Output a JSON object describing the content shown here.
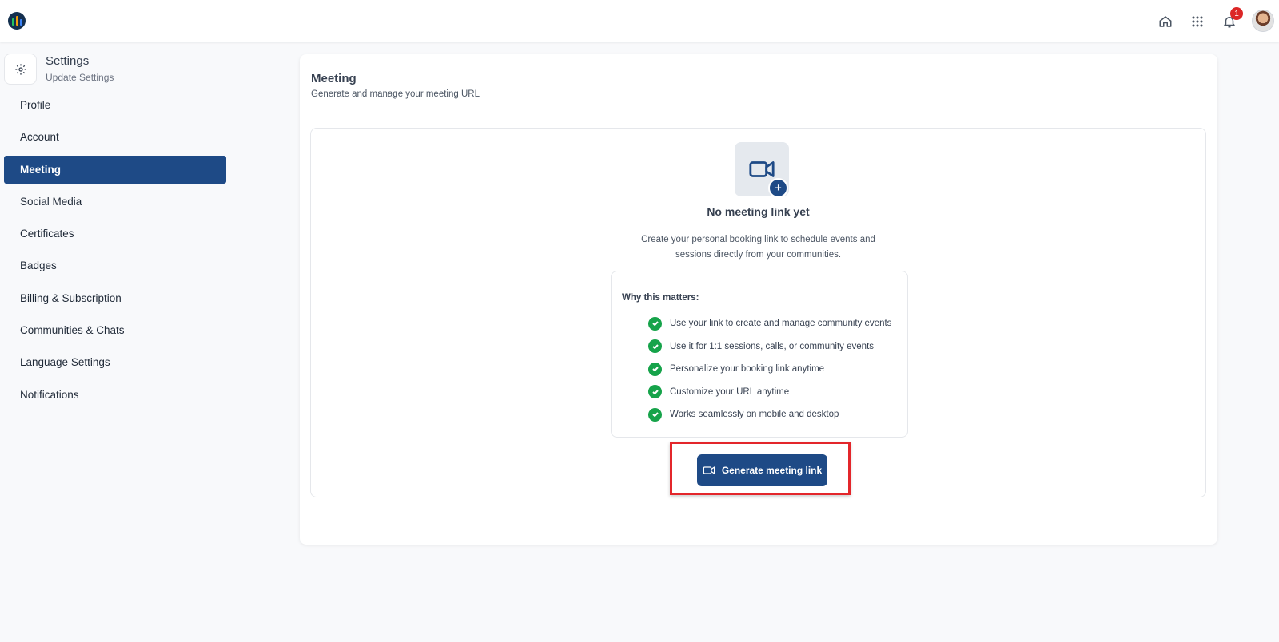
{
  "topbar": {
    "logo_icon": "app-logo-icon",
    "icons": [
      "home-icon",
      "apps-grid-icon",
      "bell-icon"
    ],
    "notification_count": "1"
  },
  "sidebar": {
    "title": "Settings",
    "subtitle": "Update Settings",
    "items": [
      {
        "label": "Profile"
      },
      {
        "label": "Account"
      },
      {
        "label": "Meeting",
        "active": true
      },
      {
        "label": "Social Media"
      },
      {
        "label": "Certificates"
      },
      {
        "label": "Badges"
      },
      {
        "label": "Billing & Subscription"
      },
      {
        "label": "Communities & Chats"
      },
      {
        "label": "Language Settings"
      },
      {
        "label": "Notifications"
      }
    ]
  },
  "main": {
    "title": "Meeting",
    "subtitle": "Generate and manage your meeting URL",
    "empty_state": {
      "title": "No meeting link yet",
      "description_line1": "Create your personal booking link to schedule events and",
      "description_line2": "sessions directly from your communities."
    },
    "why": {
      "title": "Why this matters:",
      "items": [
        "Use your link to create and manage community events",
        "Use it for 1:1 sessions, calls, or community events",
        "Personalize your booking link anytime",
        "Customize your URL anytime",
        "Works seamlessly on mobile and desktop"
      ]
    },
    "generate_button": "Generate meeting link"
  },
  "colors": {
    "primary": "#1e4a86",
    "success": "#16a34a",
    "badge": "#dc2626",
    "highlight": "#e3262b"
  }
}
